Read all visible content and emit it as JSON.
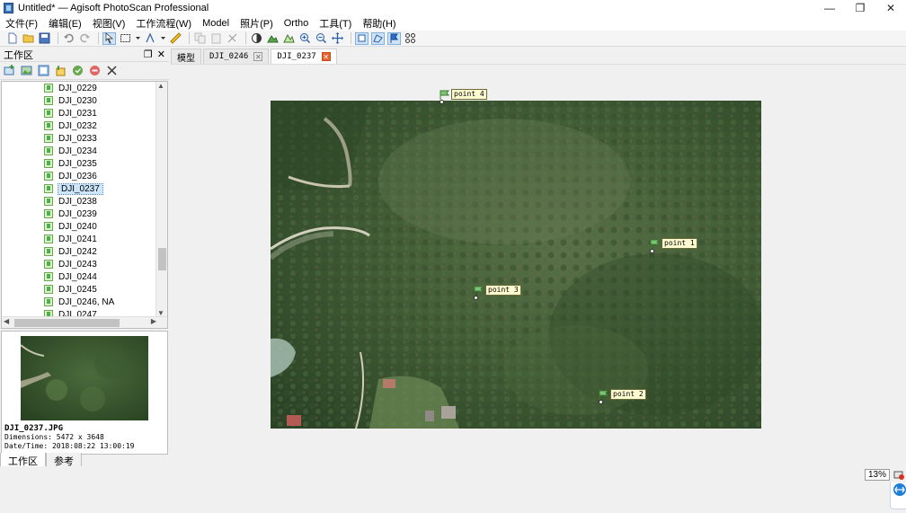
{
  "window": {
    "title": "Untitled* — Agisoft PhotoScan Professional",
    "controls": [
      "—",
      "❐",
      "✕"
    ]
  },
  "menu": [
    "文件(F)",
    "编辑(E)",
    "视图(V)",
    "工作流程(W)",
    "Model",
    "照片(P)",
    "Ortho",
    "工具(T)",
    "帮助(H)"
  ],
  "workspace": {
    "title": "工作区",
    "items": [
      "DJI_0229",
      "DJI_0230",
      "DJI_0231",
      "DJI_0232",
      "DJI_0233",
      "DJI_0234",
      "DJI_0235",
      "DJI_0236",
      "DJI_0237",
      "DJI_0238",
      "DJI_0239",
      "DJI_0240",
      "DJI_0241",
      "DJI_0242",
      "DJI_0243",
      "DJI_0244",
      "DJI_0245",
      "DJI_0246, NA",
      "DJI_0247"
    ],
    "selected": "DJI_0237"
  },
  "preview": {
    "filename": "DJI_0237.JPG",
    "dimensions": "Dimensions: 5472 x 3648",
    "datetime": "Date/Time: 2018:08:22 13:00:19"
  },
  "bottom_tabs": [
    "工作区",
    "参考"
  ],
  "doc_tabs": {
    "model": "模型",
    "tab1": "DJI_0246",
    "tab2": "DJI_0237"
  },
  "markers": [
    {
      "label": "point 4"
    },
    {
      "label": "point 1"
    },
    {
      "label": "point 3"
    },
    {
      "label": "point 2"
    }
  ],
  "status": {
    "zoom": "13%"
  },
  "colors": {
    "selection": "#cde6fb",
    "tab_close_active": "#e4632f",
    "marker_label_bg": "#fffbd0",
    "marker_flag": "#7cc576"
  }
}
